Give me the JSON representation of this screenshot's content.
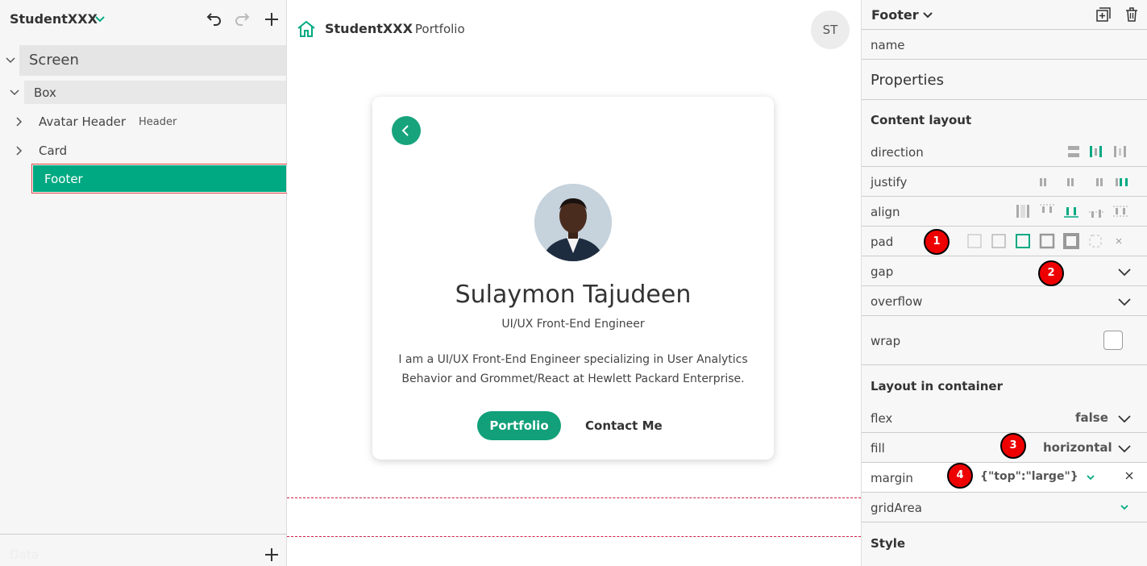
{
  "left": {
    "project_name": "StudentXXX",
    "tree": {
      "screen": "Screen",
      "box": "Box",
      "avatar_header": "Avatar Header",
      "avatar_header_tag": "Header",
      "card": "Card",
      "footer": "Footer"
    },
    "bottom_label": "Data"
  },
  "center": {
    "brand_name": "StudentXXX",
    "brand_suffix": "Portfolio",
    "avatar_initials": "ST",
    "card": {
      "name": "Sulaymon Tajudeen",
      "role": "UI/UX Front-End Engineer",
      "bio": "I am a UI/UX Front-End Engineer specializing in User Analytics Behavior and Grommet/React at Hewlett Packard Enterprise.",
      "primary_button": "Portfolio",
      "secondary_button": "Contact Me"
    }
  },
  "right": {
    "component_title": "Footer",
    "name_label": "name",
    "properties_title": "Properties",
    "content_layout_title": "Content layout",
    "direction_label": "direction",
    "justify_label": "justify",
    "align_label": "align",
    "pad_label": "pad",
    "gap_label": "gap",
    "overflow_label": "overflow",
    "wrap_label": "wrap",
    "layout_in_container_title": "Layout in container",
    "flex_label": "flex",
    "flex_value": "false",
    "fill_label": "fill",
    "fill_value": "horizontal",
    "margin_label": "margin",
    "margin_value": "{\"top\":\"large\"}",
    "grid_area_label": "gridArea",
    "style_title": "Style",
    "annotations": [
      "1",
      "2",
      "3",
      "4"
    ]
  },
  "colors": {
    "accent": "#01a982",
    "annotation": "#e00000"
  }
}
